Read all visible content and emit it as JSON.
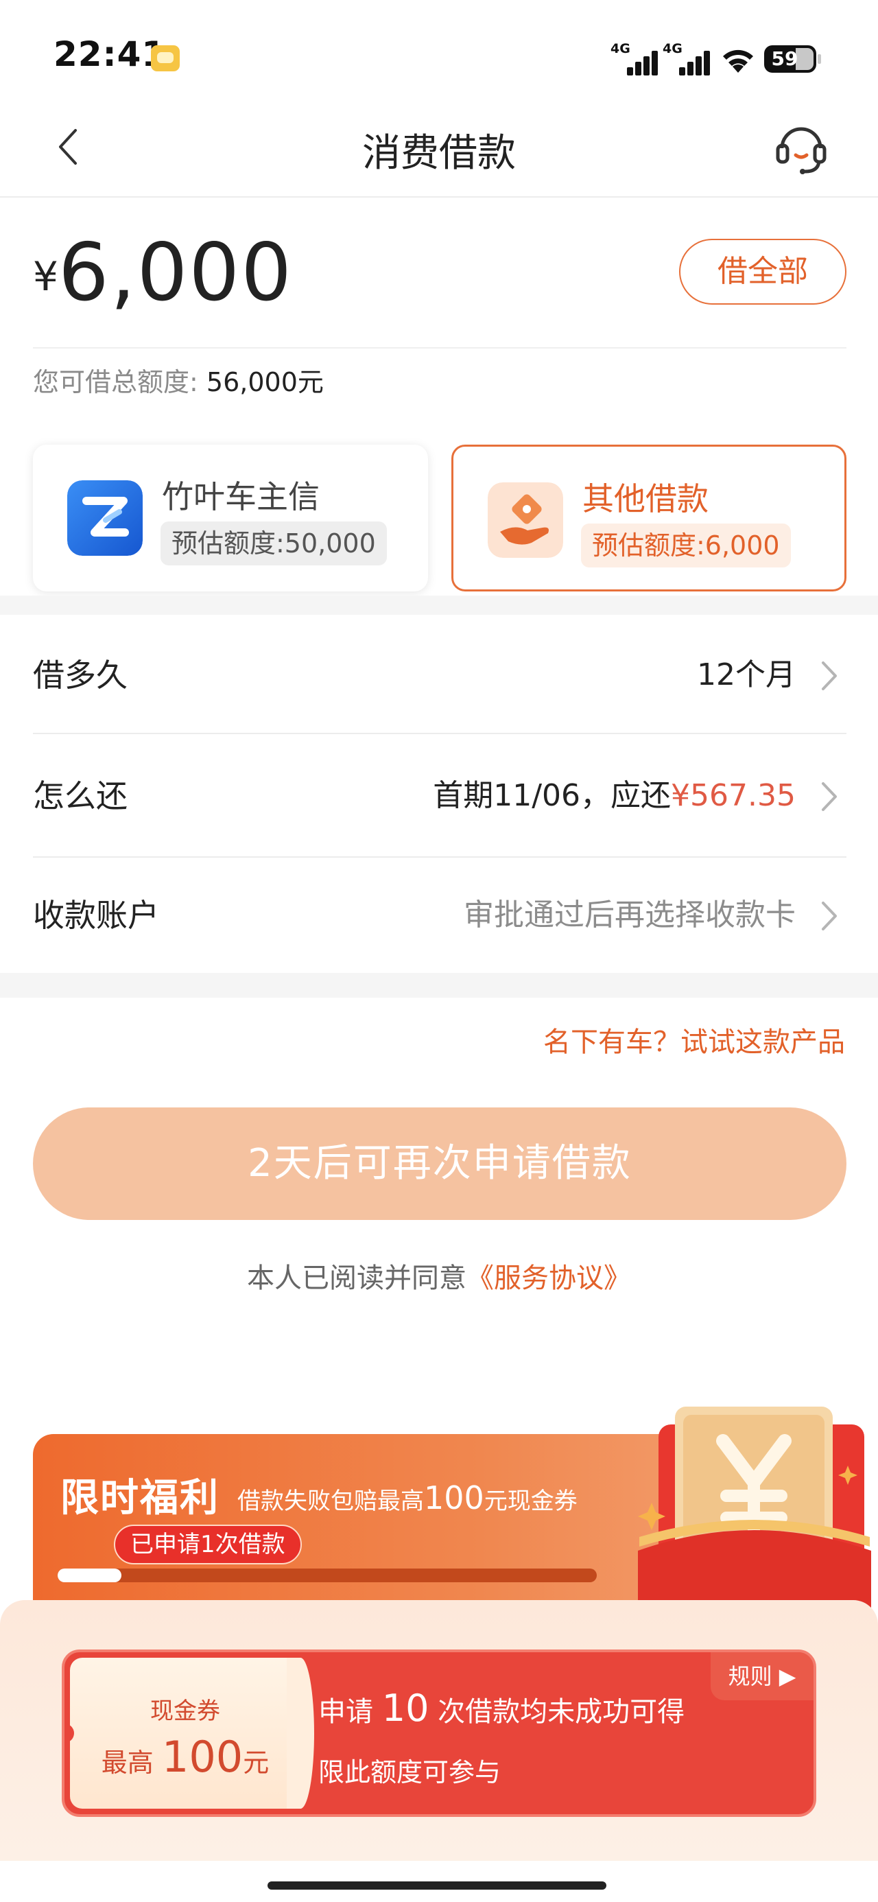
{
  "status_bar": {
    "time": "22:41",
    "signal1_label": "4G",
    "signal2_label": "4G",
    "battery": "59"
  },
  "nav": {
    "title": "消费借款"
  },
  "loan": {
    "currency_symbol": "¥",
    "amount": "6,000",
    "borrow_all_label": "借全部",
    "total_quota_label": "您可借总额度:",
    "total_quota_value": "56,000元"
  },
  "products": [
    {
      "name": "竹叶车主信",
      "quota": "预估额度:50,000",
      "selected": false,
      "color": "#1f6fe0"
    },
    {
      "name": "其他借款",
      "quota": "预估额度:6,000",
      "selected": true,
      "color": "#e7703a"
    }
  ],
  "rows": {
    "term": {
      "label": "借多久",
      "value": "12个月"
    },
    "repay": {
      "label": "怎么还",
      "value_prefix": "首期11/06，应还",
      "value_amount": "¥567.35"
    },
    "account": {
      "label": "收款账户",
      "value": "审批通过后再选择收款卡"
    }
  },
  "hint": "名下有车？试试这款产品",
  "apply_button": "2天后可再次申请借款",
  "agreement": {
    "text": "本人已阅读并同意",
    "link": "《服务协议》"
  },
  "welfare": {
    "title": "限时福利",
    "subtitle_prefix": "借款失败包赔最高",
    "subtitle_amount": "100",
    "subtitle_suffix": "元现金券",
    "badge": "已申请1次借款",
    "progress": 0.1
  },
  "coupon": {
    "label": "现金券",
    "amount_prefix": "最高",
    "amount": "100",
    "amount_suffix": "元",
    "line1_prefix": "申请",
    "line1_count": "10",
    "line1_suffix": "次借款均未成功可得",
    "line2": "限此额度可参与",
    "rules": "规则 ▶"
  },
  "colors": {
    "accent": "#e2612a",
    "price_red": "#e05a44",
    "button_disabled": "#f5c2a0"
  }
}
